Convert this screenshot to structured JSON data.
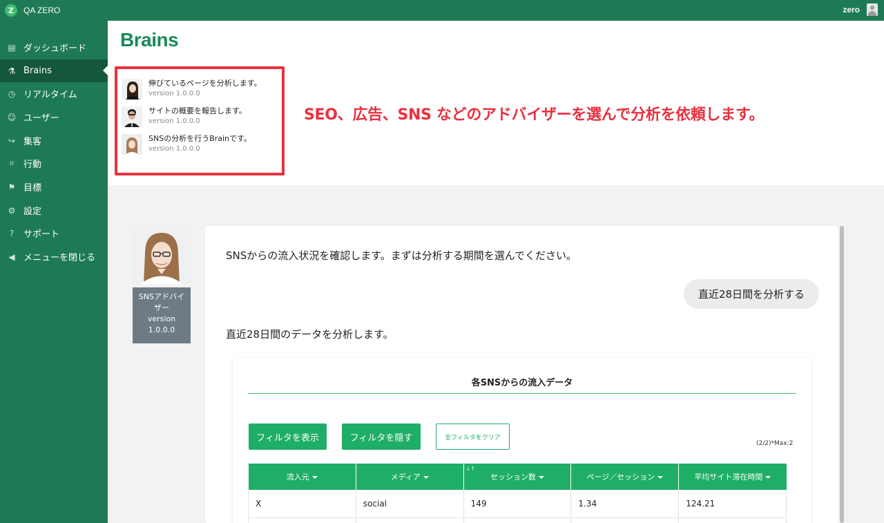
{
  "topbar": {
    "logo_letter": "Z",
    "app_title": "QA ZERO",
    "user_name": "zero"
  },
  "sidebar": {
    "items": [
      {
        "label": "ダッシュボード",
        "icon": "dashboard-icon",
        "glyph": "▤",
        "active": false
      },
      {
        "label": "Brains",
        "icon": "flask-icon",
        "glyph": "⚗",
        "active": true
      },
      {
        "label": "リアルタイム",
        "icon": "clock-icon",
        "glyph": "◷",
        "active": false
      },
      {
        "label": "ユーザー",
        "icon": "user-icon",
        "glyph": "☺",
        "active": false
      },
      {
        "label": "集客",
        "icon": "signin-icon",
        "glyph": "↪",
        "active": false
      },
      {
        "label": "行動",
        "icon": "behavior-icon",
        "glyph": "⌗",
        "active": false
      },
      {
        "label": "目標",
        "icon": "goal-icon",
        "glyph": "⚑",
        "active": false
      },
      {
        "label": "設定",
        "icon": "gear-icon",
        "glyph": "⚙",
        "active": false
      },
      {
        "label": "サポート",
        "icon": "help-icon",
        "glyph": "?",
        "active": false
      },
      {
        "label": "メニューを閉じる",
        "icon": "collapse-icon",
        "glyph": "◀",
        "active": false
      }
    ]
  },
  "header": {
    "title": "Brains",
    "brains": [
      {
        "name": "伸びているページを分析します。",
        "version": "version 1.0.0.0"
      },
      {
        "name": "サイトの概要を報告します。",
        "version": "version 1.0.0.0"
      },
      {
        "name": "SNSの分析を行うBrainです。",
        "version": "version 1.0.0.0"
      }
    ],
    "annotation": "SEO、広告、SNS などのアドバイザーを選んで分析を依頼します。"
  },
  "advisor": {
    "label_line1": "SNSアドバイ",
    "label_line2": "ザー",
    "label_line3": "version",
    "label_line4": "1.0.0.0"
  },
  "chat": {
    "msg1": "SNSからの流入状況を確認します。まずは分析する期間を選んでください。",
    "user_reply": "直近28日間を分析する",
    "msg2": "直近28日間のデータを分析します。"
  },
  "data_card": {
    "title": "各SNSからの流入データ",
    "btn_show_filter": "フィルタを表示",
    "btn_hide_filter": "フィルタを隠す",
    "btn_clear_filters": "全フィルタをクリア",
    "page_count": "(2/2)*Max:2",
    "columns": [
      "流入元",
      "メディア",
      "セッション数",
      "ページ／セッション",
      "平均サイト滞在時間"
    ],
    "rows": [
      [
        "X",
        "social",
        "149",
        "1.34",
        "124.21"
      ],
      [
        "",
        "",
        "",
        "",
        ""
      ]
    ]
  },
  "colors": {
    "brand_green": "#1e7a55",
    "active_green": "#15573c",
    "accent_green": "#1fae66",
    "annotation_red": "#e8313f"
  }
}
